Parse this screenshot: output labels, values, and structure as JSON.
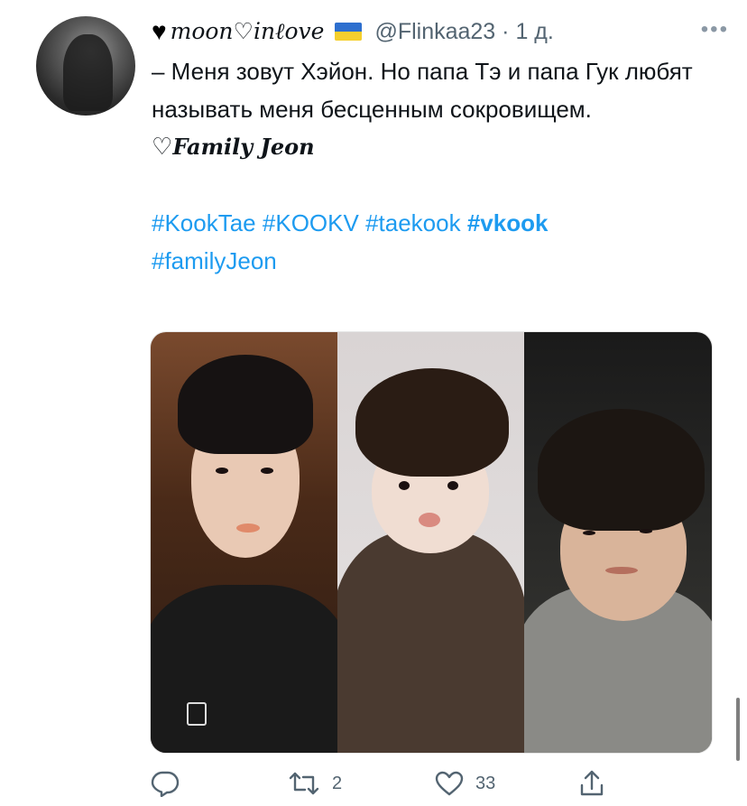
{
  "tweet": {
    "author": {
      "display_name": "moon♡inℓove",
      "handle": "@Flinkaa23",
      "time": "1 д.",
      "flag": "ukraine-flag-icon"
    },
    "text_lines": [
      "– Меня зовут Хэйон. Но папа Тэ и папа Гук любят называть меня бесценным сокровищем."
    ],
    "signature": "Family Jeon",
    "hashtags": [
      "#KookTae",
      "#KOOKV",
      "#taekook",
      "#vkook",
      "#familyJeon"
    ],
    "actions": {
      "reply_count": "",
      "retweet_count": "2",
      "like_count": "33"
    }
  },
  "colors": {
    "link": "#1d9bf0",
    "secondary_text": "#536471",
    "icon": "#536471"
  }
}
